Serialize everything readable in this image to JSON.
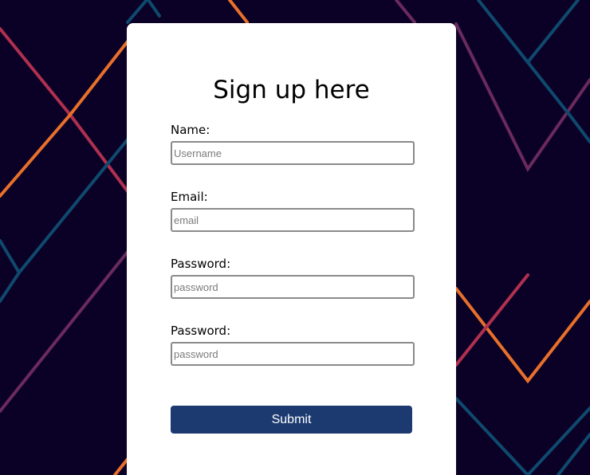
{
  "colors": {
    "background": "#0b0127",
    "card": "#ffffff",
    "accent_button": "#1c3a70",
    "line_orange": "#e8702a",
    "line_red": "#b0304f",
    "line_purple": "#6b2a5e",
    "line_blue": "#0f4a6e"
  },
  "form": {
    "title": "Sign up here",
    "fields": [
      {
        "label": "Name:",
        "placeholder": "Username",
        "value": ""
      },
      {
        "label": "Email:",
        "placeholder": "email",
        "value": ""
      },
      {
        "label": "Password:",
        "placeholder": "password",
        "value": ""
      },
      {
        "label": "Password:",
        "placeholder": "password",
        "value": ""
      }
    ],
    "submit_label": "Submit"
  }
}
